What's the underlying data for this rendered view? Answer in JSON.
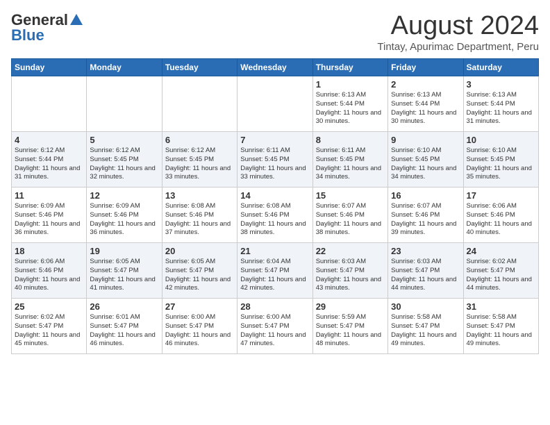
{
  "header": {
    "logo_general": "General",
    "logo_blue": "Blue",
    "title": "August 2024",
    "subtitle": "Tintay, Apurimac Department, Peru"
  },
  "days_of_week": [
    "Sunday",
    "Monday",
    "Tuesday",
    "Wednesday",
    "Thursday",
    "Friday",
    "Saturday"
  ],
  "weeks": [
    [
      {
        "day": "",
        "sunrise": "",
        "sunset": "",
        "daylight": ""
      },
      {
        "day": "",
        "sunrise": "",
        "sunset": "",
        "daylight": ""
      },
      {
        "day": "",
        "sunrise": "",
        "sunset": "",
        "daylight": ""
      },
      {
        "day": "",
        "sunrise": "",
        "sunset": "",
        "daylight": ""
      },
      {
        "day": "1",
        "sunrise": "Sunrise: 6:13 AM",
        "sunset": "Sunset: 5:44 PM",
        "daylight": "Daylight: 11 hours and 30 minutes."
      },
      {
        "day": "2",
        "sunrise": "Sunrise: 6:13 AM",
        "sunset": "Sunset: 5:44 PM",
        "daylight": "Daylight: 11 hours and 30 minutes."
      },
      {
        "day": "3",
        "sunrise": "Sunrise: 6:13 AM",
        "sunset": "Sunset: 5:44 PM",
        "daylight": "Daylight: 11 hours and 31 minutes."
      }
    ],
    [
      {
        "day": "4",
        "sunrise": "Sunrise: 6:12 AM",
        "sunset": "Sunset: 5:44 PM",
        "daylight": "Daylight: 11 hours and 31 minutes."
      },
      {
        "day": "5",
        "sunrise": "Sunrise: 6:12 AM",
        "sunset": "Sunset: 5:45 PM",
        "daylight": "Daylight: 11 hours and 32 minutes."
      },
      {
        "day": "6",
        "sunrise": "Sunrise: 6:12 AM",
        "sunset": "Sunset: 5:45 PM",
        "daylight": "Daylight: 11 hours and 33 minutes."
      },
      {
        "day": "7",
        "sunrise": "Sunrise: 6:11 AM",
        "sunset": "Sunset: 5:45 PM",
        "daylight": "Daylight: 11 hours and 33 minutes."
      },
      {
        "day": "8",
        "sunrise": "Sunrise: 6:11 AM",
        "sunset": "Sunset: 5:45 PM",
        "daylight": "Daylight: 11 hours and 34 minutes."
      },
      {
        "day": "9",
        "sunrise": "Sunrise: 6:10 AM",
        "sunset": "Sunset: 5:45 PM",
        "daylight": "Daylight: 11 hours and 34 minutes."
      },
      {
        "day": "10",
        "sunrise": "Sunrise: 6:10 AM",
        "sunset": "Sunset: 5:45 PM",
        "daylight": "Daylight: 11 hours and 35 minutes."
      }
    ],
    [
      {
        "day": "11",
        "sunrise": "Sunrise: 6:09 AM",
        "sunset": "Sunset: 5:46 PM",
        "daylight": "Daylight: 11 hours and 36 minutes."
      },
      {
        "day": "12",
        "sunrise": "Sunrise: 6:09 AM",
        "sunset": "Sunset: 5:46 PM",
        "daylight": "Daylight: 11 hours and 36 minutes."
      },
      {
        "day": "13",
        "sunrise": "Sunrise: 6:08 AM",
        "sunset": "Sunset: 5:46 PM",
        "daylight": "Daylight: 11 hours and 37 minutes."
      },
      {
        "day": "14",
        "sunrise": "Sunrise: 6:08 AM",
        "sunset": "Sunset: 5:46 PM",
        "daylight": "Daylight: 11 hours and 38 minutes."
      },
      {
        "day": "15",
        "sunrise": "Sunrise: 6:07 AM",
        "sunset": "Sunset: 5:46 PM",
        "daylight": "Daylight: 11 hours and 38 minutes."
      },
      {
        "day": "16",
        "sunrise": "Sunrise: 6:07 AM",
        "sunset": "Sunset: 5:46 PM",
        "daylight": "Daylight: 11 hours and 39 minutes."
      },
      {
        "day": "17",
        "sunrise": "Sunrise: 6:06 AM",
        "sunset": "Sunset: 5:46 PM",
        "daylight": "Daylight: 11 hours and 40 minutes."
      }
    ],
    [
      {
        "day": "18",
        "sunrise": "Sunrise: 6:06 AM",
        "sunset": "Sunset: 5:46 PM",
        "daylight": "Daylight: 11 hours and 40 minutes."
      },
      {
        "day": "19",
        "sunrise": "Sunrise: 6:05 AM",
        "sunset": "Sunset: 5:47 PM",
        "daylight": "Daylight: 11 hours and 41 minutes."
      },
      {
        "day": "20",
        "sunrise": "Sunrise: 6:05 AM",
        "sunset": "Sunset: 5:47 PM",
        "daylight": "Daylight: 11 hours and 42 minutes."
      },
      {
        "day": "21",
        "sunrise": "Sunrise: 6:04 AM",
        "sunset": "Sunset: 5:47 PM",
        "daylight": "Daylight: 11 hours and 42 minutes."
      },
      {
        "day": "22",
        "sunrise": "Sunrise: 6:03 AM",
        "sunset": "Sunset: 5:47 PM",
        "daylight": "Daylight: 11 hours and 43 minutes."
      },
      {
        "day": "23",
        "sunrise": "Sunrise: 6:03 AM",
        "sunset": "Sunset: 5:47 PM",
        "daylight": "Daylight: 11 hours and 44 minutes."
      },
      {
        "day": "24",
        "sunrise": "Sunrise: 6:02 AM",
        "sunset": "Sunset: 5:47 PM",
        "daylight": "Daylight: 11 hours and 44 minutes."
      }
    ],
    [
      {
        "day": "25",
        "sunrise": "Sunrise: 6:02 AM",
        "sunset": "Sunset: 5:47 PM",
        "daylight": "Daylight: 11 hours and 45 minutes."
      },
      {
        "day": "26",
        "sunrise": "Sunrise: 6:01 AM",
        "sunset": "Sunset: 5:47 PM",
        "daylight": "Daylight: 11 hours and 46 minutes."
      },
      {
        "day": "27",
        "sunrise": "Sunrise: 6:00 AM",
        "sunset": "Sunset: 5:47 PM",
        "daylight": "Daylight: 11 hours and 46 minutes."
      },
      {
        "day": "28",
        "sunrise": "Sunrise: 6:00 AM",
        "sunset": "Sunset: 5:47 PM",
        "daylight": "Daylight: 11 hours and 47 minutes."
      },
      {
        "day": "29",
        "sunrise": "Sunrise: 5:59 AM",
        "sunset": "Sunset: 5:47 PM",
        "daylight": "Daylight: 11 hours and 48 minutes."
      },
      {
        "day": "30",
        "sunrise": "Sunrise: 5:58 AM",
        "sunset": "Sunset: 5:47 PM",
        "daylight": "Daylight: 11 hours and 49 minutes."
      },
      {
        "day": "31",
        "sunrise": "Sunrise: 5:58 AM",
        "sunset": "Sunset: 5:47 PM",
        "daylight": "Daylight: 11 hours and 49 minutes."
      }
    ]
  ]
}
